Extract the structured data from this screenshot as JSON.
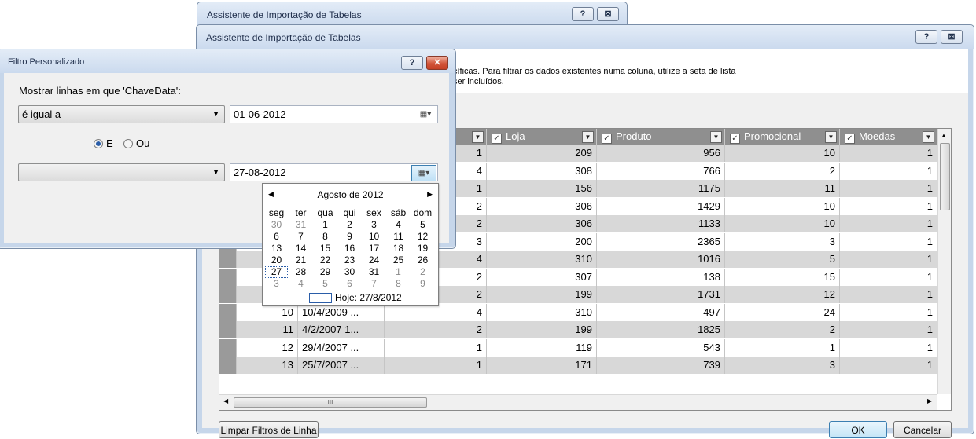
{
  "back_window": {
    "title": "Assistente de Importação de Tabelas",
    "help": "?",
    "close": "⊠"
  },
  "main_window": {
    "title": "Assistente de Importação de Tabelas",
    "help": "?",
    "close": "⊠",
    "info_line1": "cíficas. Para filtrar os dados existentes numa coluna, utilize a seta de lista",
    "info_line2": "ser incluídos.",
    "columns": [
      "Loja",
      "Produto",
      "Promocional",
      "Moedas"
    ],
    "rows": [
      {
        "n": "",
        "date": "",
        "c1": "1",
        "loja": "209",
        "prod": "956",
        "promo": "10",
        "moedas": "1"
      },
      {
        "n": "",
        "date": "",
        "c1": "4",
        "loja": "308",
        "prod": "766",
        "promo": "2",
        "moedas": "1"
      },
      {
        "n": "",
        "date": "",
        "c1": "1",
        "loja": "156",
        "prod": "1175",
        "promo": "11",
        "moedas": "1"
      },
      {
        "n": "",
        "date": "",
        "c1": "2",
        "loja": "306",
        "prod": "1429",
        "promo": "10",
        "moedas": "1"
      },
      {
        "n": "",
        "date": "",
        "c1": "2",
        "loja": "306",
        "prod": "1133",
        "promo": "10",
        "moedas": "1"
      },
      {
        "n": "",
        "date": "",
        "c1": "3",
        "loja": "200",
        "prod": "2365",
        "promo": "3",
        "moedas": "1"
      },
      {
        "n": "",
        "date": "",
        "c1": "4",
        "loja": "310",
        "prod": "1016",
        "promo": "5",
        "moedas": "1"
      },
      {
        "n": "",
        "date": "",
        "c1": "2",
        "loja": "307",
        "prod": "138",
        "promo": "15",
        "moedas": "1"
      },
      {
        "n": "",
        "date": "",
        "c1": "2",
        "loja": "199",
        "prod": "1731",
        "promo": "12",
        "moedas": "1"
      },
      {
        "n": "10",
        "date": "10/4/2009 ...",
        "c1": "4",
        "loja": "310",
        "prod": "497",
        "promo": "24",
        "moedas": "1"
      },
      {
        "n": "11",
        "date": "4/2/2007 1...",
        "c1": "2",
        "loja": "199",
        "prod": "1825",
        "promo": "2",
        "moedas": "1"
      },
      {
        "n": "12",
        "date": "29/4/2007 ...",
        "c1": "1",
        "loja": "119",
        "prod": "543",
        "promo": "1",
        "moedas": "1"
      },
      {
        "n": "13",
        "date": "25/7/2007 ...",
        "c1": "1",
        "loja": "171",
        "prod": "739",
        "promo": "3",
        "moedas": "1"
      }
    ],
    "hscroll_grip": "III",
    "clear_button": "Limpar Filtros de Linha",
    "ok_button": "OK",
    "cancel_button": "Cancelar"
  },
  "filter_dialog": {
    "title": "Filtro Personalizado",
    "help": "?",
    "close": "✕",
    "prompt": "Mostrar linhas em que 'ChaveData':",
    "operator1": "é igual a",
    "value1": "01-06-2012",
    "radio_and": "E",
    "radio_or": "Ou",
    "operator2": "",
    "value2": "27-08-2012"
  },
  "calendar": {
    "month_label": "Agosto de 2012",
    "weekdays": [
      "seg",
      "ter",
      "qua",
      "qui",
      "sex",
      "sáb",
      "dom"
    ],
    "weeks": [
      [
        "30",
        "31",
        "1",
        "2",
        "3",
        "4",
        "5"
      ],
      [
        "6",
        "7",
        "8",
        "9",
        "10",
        "11",
        "12"
      ],
      [
        "13",
        "14",
        "15",
        "16",
        "17",
        "18",
        "19"
      ],
      [
        "20",
        "21",
        "22",
        "23",
        "24",
        "25",
        "26"
      ],
      [
        "27",
        "28",
        "29",
        "30",
        "31",
        "1",
        "2"
      ],
      [
        "3",
        "4",
        "5",
        "6",
        "7",
        "8",
        "9"
      ]
    ],
    "today_label": "Hoje: 27/8/2012"
  }
}
